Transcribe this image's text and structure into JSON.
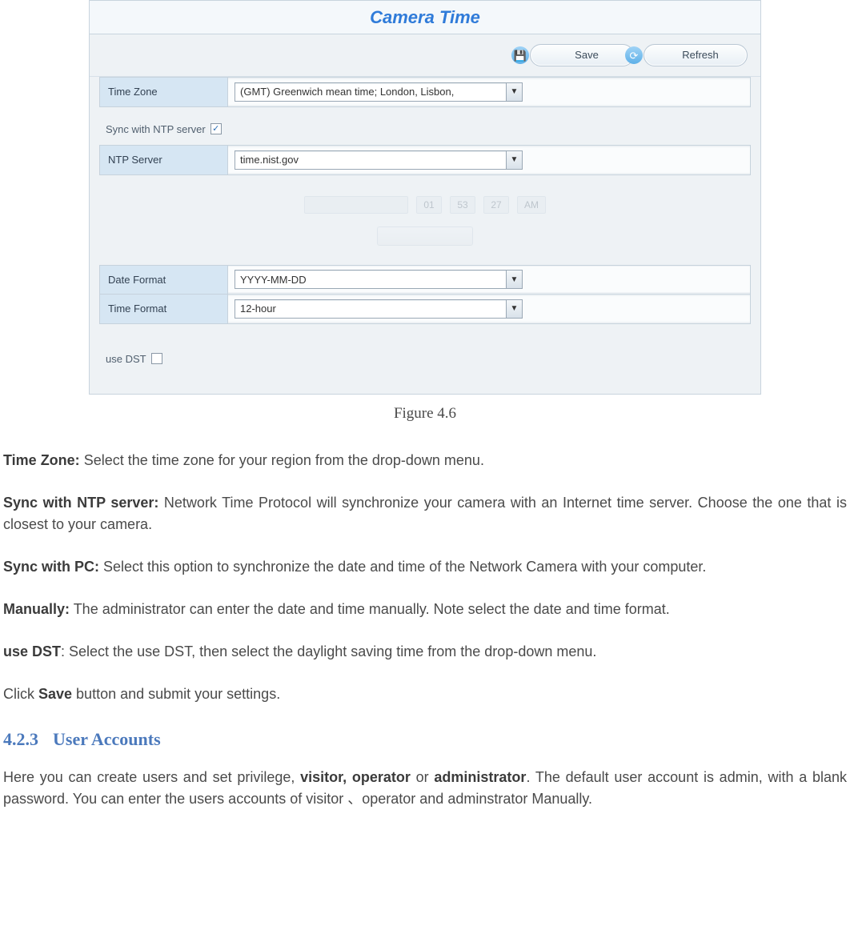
{
  "screenshot": {
    "title": "Camera Time",
    "buttons": {
      "save": "Save",
      "refresh": "Refresh"
    },
    "rows": {
      "timezone": {
        "label": "Time Zone",
        "value": "(GMT) Greenwich mean time; London, Lisbon,"
      },
      "syncntp": {
        "label": "Sync with NTP server",
        "checked": true
      },
      "ntpserver": {
        "label": "NTP Server",
        "value": "time.nist.gov"
      },
      "ghost": {
        "date": "",
        "h": "01",
        "m": "53",
        "s": "27",
        "ampm": "AM"
      },
      "dateformat": {
        "label": "Date Format",
        "value": "YYYY-MM-DD"
      },
      "timeformat": {
        "label": "Time Format",
        "value": "12-hour"
      },
      "usedst": {
        "label": "use DST",
        "checked": false
      }
    }
  },
  "caption": "Figure 4.6",
  "paragraphs": {
    "p1_bold": "Time Zone:",
    "p1_rest": " Select the time zone for your region from the drop-down menu.",
    "p2_bold": "Sync with NTP server:",
    "p2_rest": " Network Time Protocol will synchronize your camera with an Internet time server. Choose the one that is closest to your camera.",
    "p3_bold": "Sync with PC:",
    "p3_rest": " Select this option to synchronize the date and time of the Network Camera with your computer.",
    "p4_bold": "Manually:",
    "p4_rest": " The administrator can enter the date and time manually. Note select the date and time format.",
    "p5_bold": "use DST",
    "p5_rest": ": Select the use DST, then select the daylight saving time from the drop-down menu.",
    "p6_a": "Click ",
    "p6_bold": "Save",
    "p6_b": " button and submit your settings."
  },
  "section": {
    "num": "4.2.3",
    "title": "User Accounts",
    "body_a": "Here you can create users and set privilege, ",
    "body_bold1": "visitor, operator",
    "body_mid": " or ",
    "body_bold2": "administrator",
    "body_b": ". The default user account is admin, with a blank password. You can enter the users accounts of visitor 、operator and adminstrator Manually."
  }
}
